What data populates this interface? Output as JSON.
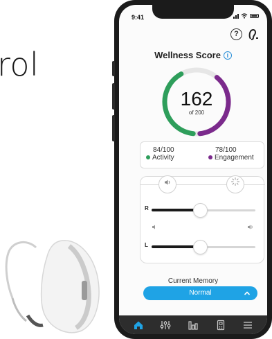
{
  "background": {
    "word": "rol"
  },
  "status_bar": {
    "time": "9:41"
  },
  "wellness": {
    "title": "Wellness Score",
    "score": "162",
    "score_of": "of 200",
    "score_value": 162,
    "score_max": 200,
    "activity_value": 84,
    "engagement_value": 78
  },
  "metrics": {
    "activity": {
      "value": "84/100",
      "label": "Activity",
      "color": "#2e9e5b"
    },
    "engagement": {
      "value": "78/100",
      "label": "Engagement",
      "color": "#7b2a8c"
    }
  },
  "volume": {
    "right": {
      "label": "R",
      "level": 0.47
    },
    "left": {
      "label": "L",
      "level": 0.47
    },
    "modes": [
      "speaker-icon",
      "sparkle-icon"
    ]
  },
  "memory": {
    "label": "Current Memory",
    "selected": "Normal"
  },
  "colors": {
    "accent": "#1fa3e5",
    "activity": "#2e9e5b",
    "engagement": "#7b2a8c",
    "tabbar": "#2d2d2d",
    "home_active": "#1fa3e5"
  },
  "tabs": [
    "home-icon",
    "equalizer-icon",
    "stats-icon",
    "remote-icon",
    "menu-icon"
  ]
}
